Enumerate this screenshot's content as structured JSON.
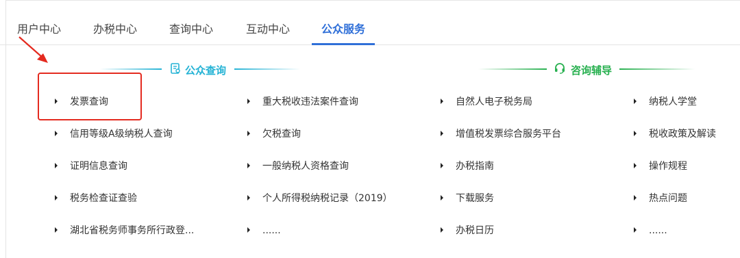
{
  "tabs": [
    {
      "label": "用户中心",
      "active": false
    },
    {
      "label": "办税中心",
      "active": false
    },
    {
      "label": "查询中心",
      "active": false
    },
    {
      "label": "互动中心",
      "active": false
    },
    {
      "label": "公众服务",
      "active": true
    }
  ],
  "sections": {
    "public_query": {
      "title": "公众查询",
      "icon": "document-search-icon",
      "color": "#25b3d5"
    },
    "consulting": {
      "title": "咨询辅导",
      "icon": "headset-icon",
      "color": "#27b04f"
    }
  },
  "columns": [
    [
      "发票查询",
      "信用等级A级纳税人查询",
      "证明信息查询",
      "税务检查证查验",
      "湖北省税务师事务所行政登..."
    ],
    [
      "重大税收违法案件查询",
      "欠税查询",
      "一般纳税人资格查询",
      "个人所得税纳税记录（2019）",
      "......"
    ],
    [
      "自然人电子税务局",
      "增值税发票综合服务平台",
      "办税指南",
      "下载服务",
      "办税日历"
    ],
    [
      "纳税人学堂",
      "税收政策及解读",
      "操作规程",
      "热点问题",
      "......"
    ]
  ],
  "colors": {
    "accent_blue": "#2f6fd8",
    "annotation_red": "#e42a1f"
  }
}
